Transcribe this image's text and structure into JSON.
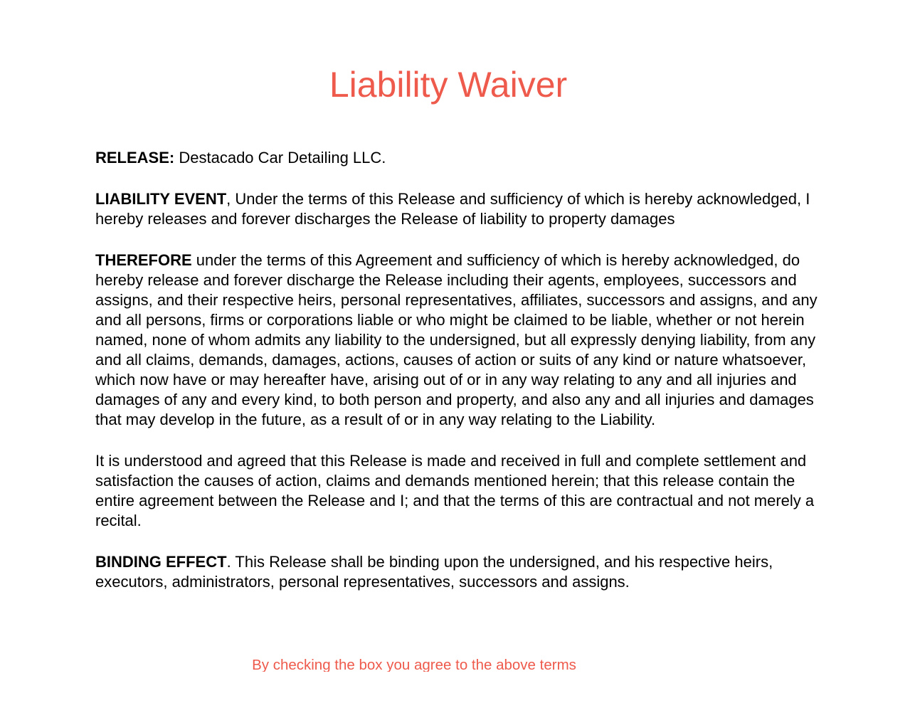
{
  "title": "Liability Waiver",
  "release": {
    "label": "RELEASE:",
    "text": " Destacado Car Detailing LLC."
  },
  "liability_event": {
    "label": "LIABILITY EVENT",
    "text": ", Under the terms of this Release and sufficiency of which is hereby acknowledged, I hereby releases and forever discharges the Release of liability to property damages"
  },
  "therefore": {
    "label": "THEREFORE",
    "text": " under the terms of this Agreement and sufficiency of which is hereby acknowledged, do hereby release and forever discharge the Release including their agents, employees, successors and assigns, and their respective heirs, personal representatives, affiliates, successors and assigns, and any and all persons, firms or corporations liable or who might be claimed to be liable, whether or not herein named, none of whom admits any liability to the undersigned, but all expressly denying liability, from any and all claims, demands, damages, actions, causes of action or suits of any kind or nature whatsoever, which now have or may hereafter have, arising out of or in any way relating to any and all injuries and damages of any and every kind, to both person and property, and also any and all injuries and damages that may develop in the future, as a result of or in any way relating to the Liability."
  },
  "understood": {
    "text": "It is understood and agreed that this Release is made and received in full and complete settlement and satisfaction the causes of action, claims and demands mentioned herein; that this release contain the entire agreement between the Release and I; and that the terms of this are contractual and not merely a recital."
  },
  "binding_effect": {
    "label": "BINDING EFFECT",
    "text": ". This Release shall be binding upon the undersigned, and his respective heirs, executors, administrators, personal representatives, successors and assigns."
  },
  "footer_note": "By checking the box you agree to the above terms",
  "colors": {
    "accent": "#ee5a4b",
    "text": "#000000",
    "background": "#ffffff"
  }
}
